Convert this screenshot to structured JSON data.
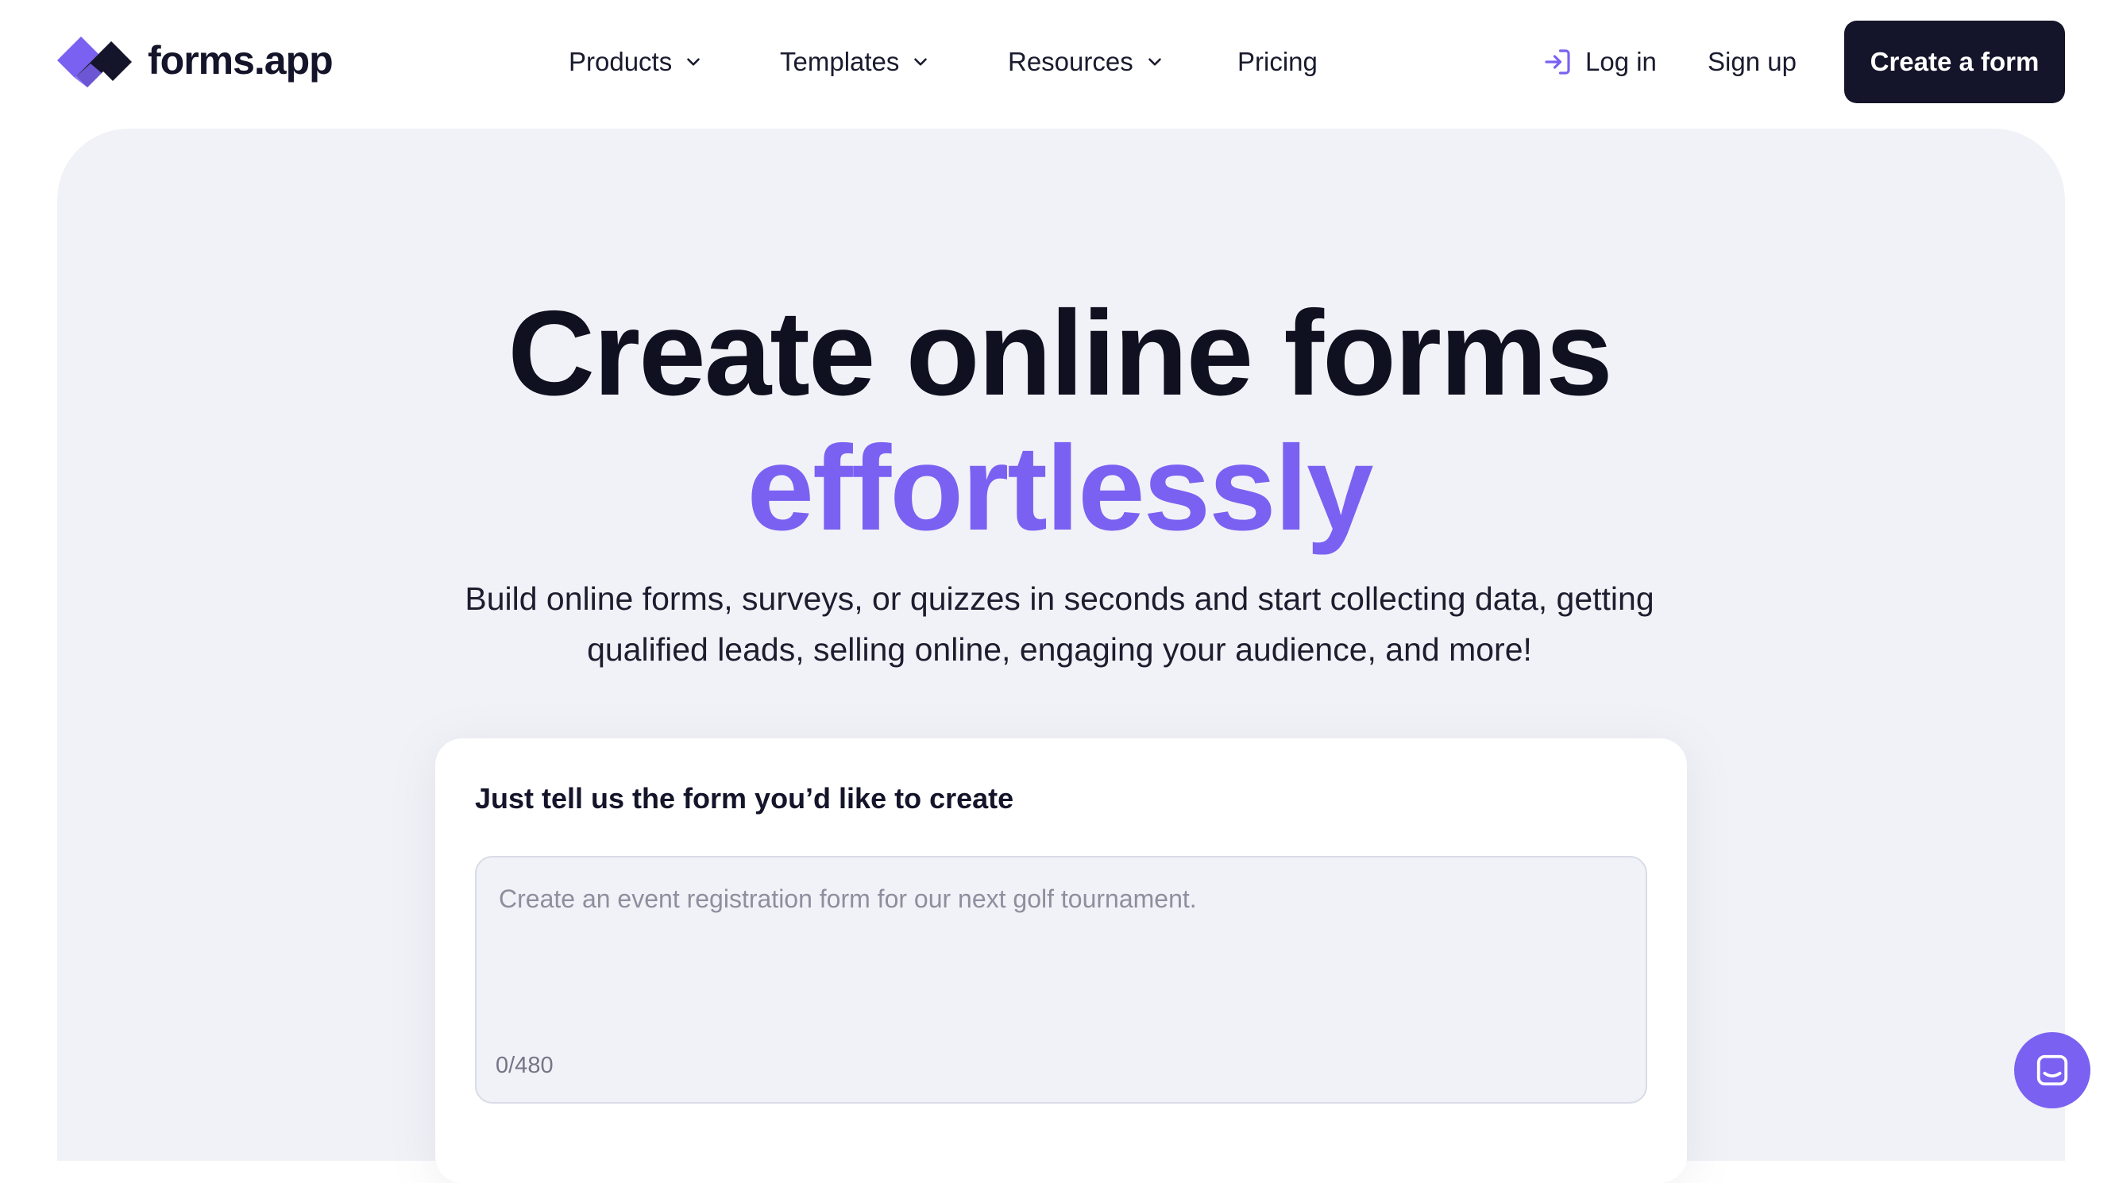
{
  "brand": {
    "name": "forms.app",
    "accent": "#7b61f2",
    "dark": "#14152a"
  },
  "nav": {
    "items": [
      {
        "label": "Products",
        "icon": "chevron-down-icon"
      },
      {
        "label": "Templates",
        "icon": "chevron-down-icon"
      },
      {
        "label": "Resources",
        "icon": "chevron-down-icon"
      },
      {
        "label": "Pricing"
      }
    ],
    "login_label": "Log in",
    "login_icon": "login-icon",
    "signup_label": "Sign up",
    "cta_label": "Create a form"
  },
  "hero": {
    "title_line1": "Create online forms",
    "title_line2": "effortlessly",
    "subtitle_line1": "Build online forms, surveys, or quizzes in seconds and start collecting data, getting",
    "subtitle_line2": "qualified leads, selling online, engaging your audience, and more!"
  },
  "prompt": {
    "label": "Just tell us the form you’d like to create",
    "placeholder": "Create an event registration form for our next golf tournament.",
    "counter": "0/480"
  },
  "chat_widget": {
    "icon": "chat-icon"
  }
}
